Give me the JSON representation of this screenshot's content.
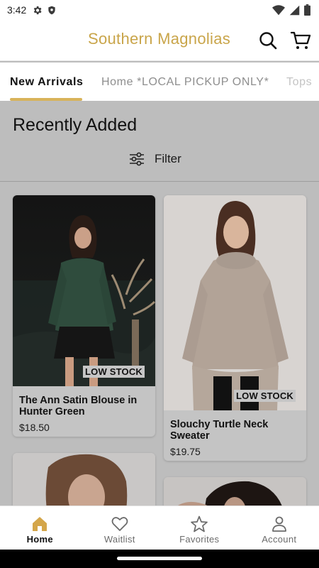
{
  "status_bar": {
    "time": "3:42"
  },
  "header": {
    "title": "Southern Magnolias"
  },
  "tabs": [
    {
      "label": "New Arrivals",
      "active": true
    },
    {
      "label": "Home *LOCAL PICKUP ONLY*",
      "active": false
    },
    {
      "label": "Tops",
      "active": false
    }
  ],
  "section": {
    "title": "Recently Added",
    "filter_label": "Filter"
  },
  "products": [
    {
      "name": "The Ann Satin Blouse in Hunter Green",
      "price": "$18.50",
      "badge": "LOW STOCK"
    },
    {
      "name": "Slouchy Turtle Neck Sweater",
      "price": "$19.75",
      "badge": "LOW STOCK"
    }
  ],
  "bottom_nav": [
    {
      "label": "Home",
      "icon": "home-icon",
      "active": true
    },
    {
      "label": "Waitlist",
      "icon": "heart-icon",
      "active": false
    },
    {
      "label": "Favorites",
      "icon": "star-icon",
      "active": false
    },
    {
      "label": "Account",
      "icon": "person-icon",
      "active": false
    }
  ],
  "colors": {
    "brand_gold": "#c9a54a",
    "tab_indicator": "#d8b35a",
    "home_icon": "#d4a64a"
  }
}
